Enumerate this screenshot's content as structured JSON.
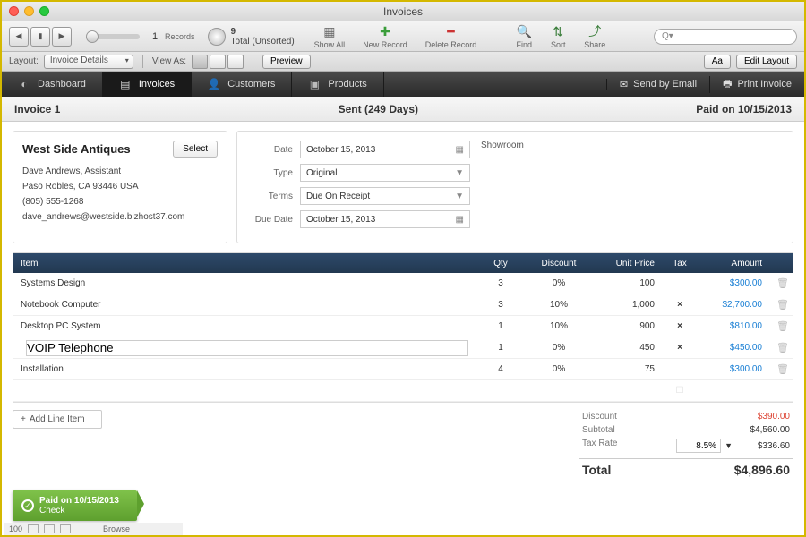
{
  "window": {
    "title": "Invoices"
  },
  "toolbar": {
    "record_index": "1",
    "records_label": "Records",
    "records_count": "9",
    "records_sort": "Total (Unsorted)",
    "show_all": "Show All",
    "new_record": "New Record",
    "delete_record": "Delete Record",
    "find": "Find",
    "sort": "Sort",
    "share": "Share",
    "search_placeholder": "Q"
  },
  "layoutbar": {
    "layout_label": "Layout:",
    "layout_value": "Invoice Details",
    "view_label": "View As:",
    "preview": "Preview",
    "aa": "Aa",
    "edit_layout": "Edit Layout"
  },
  "tabs": {
    "dashboard": "Dashboard",
    "invoices": "Invoices",
    "customers": "Customers",
    "products": "Products",
    "send_email": "Send by Email",
    "print": "Print Invoice"
  },
  "info": {
    "left": "Invoice 1",
    "center": "Sent (249 Days)",
    "right": "Paid on 10/15/2013"
  },
  "customer": {
    "name": "West Side Antiques",
    "select": "Select",
    "contact": "Dave Andrews, Assistant",
    "address": "Paso Robles, CA 93446 USA",
    "phone": "(805) 555-1268",
    "email": "dave_andrews@westside.bizhost37.com"
  },
  "details": {
    "date_label": "Date",
    "date_value": "October 15, 2013",
    "type_label": "Type",
    "type_value": "Original",
    "terms_label": "Terms",
    "terms_value": "Due On Receipt",
    "due_label": "Due Date",
    "due_value": "October 15, 2013",
    "note": "Showroom"
  },
  "table": {
    "headers": {
      "item": "Item",
      "qty": "Qty",
      "discount": "Discount",
      "unit_price": "Unit Price",
      "tax": "Tax",
      "amount": "Amount"
    },
    "rows": [
      {
        "item": "Systems Design",
        "qty": "3",
        "discount": "0%",
        "price": "100",
        "tax": "",
        "amount": "$300.00"
      },
      {
        "item": "Notebook Computer",
        "qty": "3",
        "discount": "10%",
        "price": "1,000",
        "tax": "×",
        "amount": "$2,700.00"
      },
      {
        "item": "Desktop PC System",
        "qty": "1",
        "discount": "10%",
        "price": "900",
        "tax": "×",
        "amount": "$810.00"
      },
      {
        "item": "VOIP Telephone",
        "qty": "1",
        "discount": "0%",
        "price": "450",
        "tax": "×",
        "amount": "$450.00"
      },
      {
        "item": "Installation",
        "qty": "4",
        "discount": "0%",
        "price": "75",
        "tax": "",
        "amount": "$300.00"
      }
    ],
    "add_line": "Add Line Item"
  },
  "totals": {
    "discount_label": "Discount",
    "discount": "$390.00",
    "subtotal_label": "Subtotal",
    "subtotal": "$4,560.00",
    "taxrate_label": "Tax Rate",
    "taxrate": "8.5%",
    "tax": "$336.60",
    "total_label": "Total",
    "total": "$4,896.60"
  },
  "paid_badge": {
    "line1": "Paid on 10/15/2013",
    "line2": "Check"
  },
  "footer": {
    "zoom": "100",
    "browse": "Browse"
  }
}
